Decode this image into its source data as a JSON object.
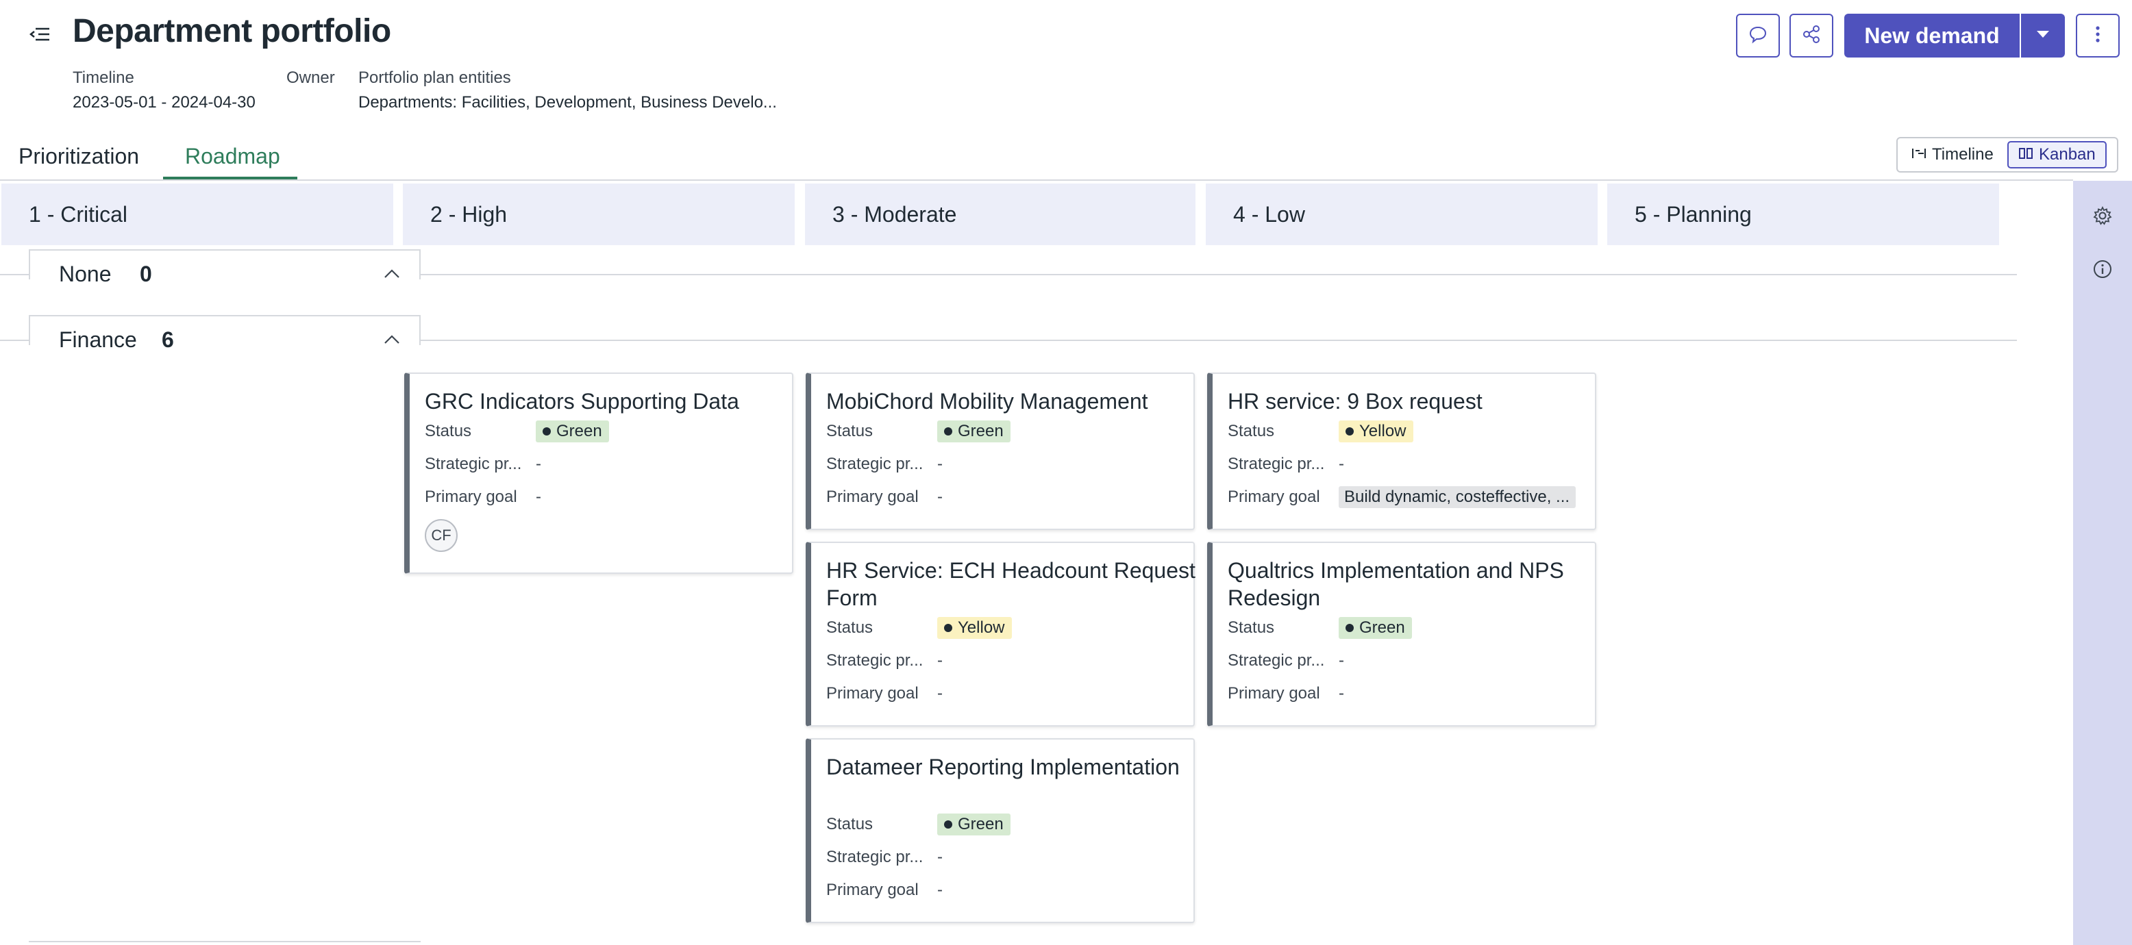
{
  "header": {
    "title": "Department portfolio",
    "timeline_label": "Timeline",
    "timeline_value": "2023-05-01 - 2024-04-30",
    "owner_label": "Owner",
    "entities_label": "Portfolio plan entities",
    "entities_value": "Departments: Facilities, Development, Business Develo...",
    "new_demand_label": "New demand"
  },
  "tabs": [
    {
      "label": "Prioritization"
    },
    {
      "label": "Roadmap"
    }
  ],
  "view_toggle": {
    "timeline_label": "Timeline",
    "kanban_label": "Kanban",
    "active": "Kanban"
  },
  "columns": [
    {
      "label": "1 - Critical"
    },
    {
      "label": "2 - High"
    },
    {
      "label": "3 - Moderate"
    },
    {
      "label": "4 - Low"
    },
    {
      "label": "5 - Planning"
    }
  ],
  "lanes": [
    {
      "name": "None",
      "count": "0"
    },
    {
      "name": "Finance",
      "count": "6"
    }
  ],
  "field_labels": {
    "status": "Status",
    "strategic": "Strategic pr...",
    "goal": "Primary goal"
  },
  "cards": [
    {
      "title": "GRC Indicators Supporting Data",
      "status": "Green",
      "strategic": "-",
      "goal": "-",
      "avatar": "CF"
    },
    {
      "title": "MobiChord Mobility Management",
      "status": "Green",
      "strategic": "-",
      "goal": "-"
    },
    {
      "title": "HR Service: ECH Headcount Request Form",
      "status": "Yellow",
      "strategic": "-",
      "goal": "-"
    },
    {
      "title": "Datameer Reporting Implementation",
      "status": "Green",
      "strategic": "-",
      "goal": "-"
    },
    {
      "title": "HR service: 9 Box request",
      "status": "Yellow",
      "strategic": "-",
      "goal": "Build dynamic, costeffective, ..."
    },
    {
      "title": "Qualtrics Implementation and NPS Redesign",
      "status": "Green",
      "strategic": "-",
      "goal": "-"
    }
  ],
  "colors": {
    "accent": "#4f52bd",
    "tab_active": "#2e7d5b",
    "column_header_bg": "#eceef9",
    "rail_bg": "#d6d8f1",
    "status_green_bg": "#d6ead1",
    "status_yellow_bg": "#fbf2c0",
    "card_stripe": "#646d78"
  },
  "icons": {
    "collapse": "collapse-sidebar-icon",
    "comment": "comment-icon",
    "share": "share-icon",
    "caret": "caret-down-icon",
    "more": "more-vertical-icon",
    "timeline": "timeline-icon",
    "kanban": "kanban-icon",
    "settings": "gear-icon",
    "info": "info-icon",
    "chevron": "chevron-up-icon"
  }
}
